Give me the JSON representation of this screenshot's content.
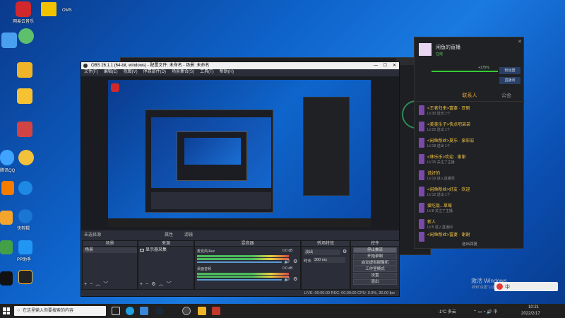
{
  "desktop": {
    "icons": [
      {
        "label": "网易云音乐"
      },
      {
        "label": "OMS"
      },
      {
        "label": "腾讯QQ"
      },
      {
        "label": "快剪辑"
      },
      {
        "label": "PP助手"
      }
    ]
  },
  "obs": {
    "title": "OBS 26.1.1 (64-bit, windows) - 配置文件: 未命名 - 场景: 未命名",
    "menu": [
      "文件(F)",
      "编辑(E)",
      "视图(V)",
      "停靠部件(D)",
      "场景集合(S)",
      "工具(T)",
      "帮助(H)"
    ],
    "no_source": "未选择源",
    "props_btn": "属性",
    "filters_btn": "滤镜",
    "panels": {
      "scenes": "场景",
      "sources": "来源",
      "mixer": "混音器",
      "transitions": "转场特效",
      "controls": "控件"
    },
    "scene_item": "场景",
    "source_item": "显示器采集",
    "mixer_tracks": [
      {
        "name": "桌面音频",
        "db": "0.0 dB"
      },
      {
        "name": "麦克风/Aux",
        "db": "0.0 dB"
      }
    ],
    "transition": {
      "type": "淡出",
      "duration_label": "时长",
      "duration": "300 ms"
    },
    "controls": [
      "停止推流",
      "开始录制",
      "启动虚拟摄像机",
      "工作室模式",
      "设置",
      "退出"
    ],
    "status": "LIVE: 00:00:00   REC: 00:00:00   CPU: 0.9%, 30.00 fps"
  },
  "chat": {
    "username": "闲鱼的直播",
    "badge": "在线",
    "progress_label": "+175%",
    "btn1": "粉丝团",
    "btn2": "直播间",
    "tabs": [
      "",
      "联系人",
      "公会"
    ],
    "messages": [
      {
        "name": "<王者归来>富婆 · 亚丽",
        "sub": "LV.30  送出 1个"
      },
      {
        "name": "<美美乐子>快点吧弟弟",
        "sub": "LV.22  送出 1个"
      },
      {
        "name": "<闲鱼粉丝>夏乐 · 泉彩宏",
        "sub": "LV.18  送出 1个"
      },
      {
        "name": "<林乐乐>欢迎 · 谢谢",
        "sub": "LV.15  关注了主播"
      },
      {
        "name": "说好的",
        "sub": "LV.10  进入直播间"
      },
      {
        "name": "<闲鱼粉丝>好友 · 欢迎",
        "sub": "LV.12  送出 1个"
      },
      {
        "name": "爱吃饭...草莓",
        "sub": "LV.8  关注了主播"
      },
      {
        "name": "新人",
        "sub": "LV.5  进入直播间"
      },
      {
        "name": "<闲鱼粉丝>富婆 · 谢谢",
        "sub": "LV.20  送出 5个"
      }
    ],
    "footer": "送出回复"
  },
  "watermark": {
    "line1": "激活 Windows",
    "line2": "转到\"设置\"以激活 Windows。"
  },
  "taskbar": {
    "search_placeholder": "在这里输入你要搜索的内容",
    "weather": "-1°C 多云",
    "time": "10:21",
    "date": "2022/2/17",
    "ime": "中"
  }
}
